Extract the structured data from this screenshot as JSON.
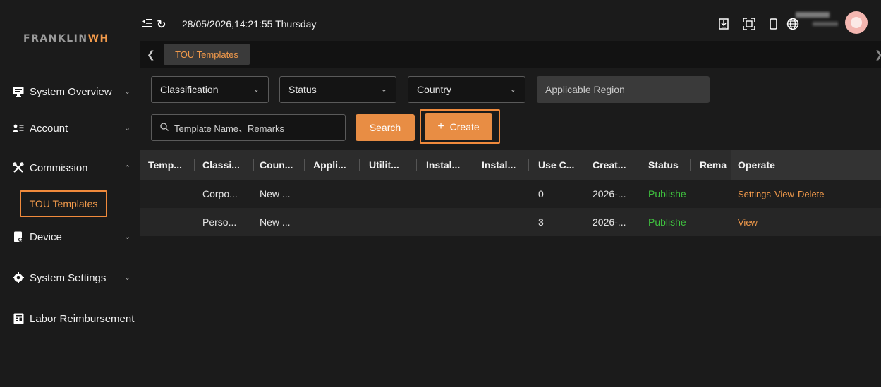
{
  "brand": {
    "logo_main": "FRANKLIN",
    "logo_accent": "WH"
  },
  "header": {
    "datetime": "28/05/2026,14:21:55 Thursday",
    "user_name": "",
    "user_role": ""
  },
  "sidebar": {
    "items": [
      {
        "label": "System Overview",
        "icon": "monitor-icon"
      },
      {
        "label": "Account",
        "icon": "account-icon"
      },
      {
        "label": "Commission",
        "icon": "tools-icon"
      },
      {
        "label": "Device",
        "icon": "device-icon"
      },
      {
        "label": "System Settings",
        "icon": "gear-icon"
      },
      {
        "label": "Labor Reimbursement",
        "icon": "receipt-icon"
      }
    ],
    "sub_item": {
      "label": "TOU Templates"
    }
  },
  "tabs": [
    {
      "label": "TOU Templates"
    }
  ],
  "filters": {
    "classification": "Classification",
    "status": "Status",
    "country": "Country",
    "applicable_region": "Applicable Region",
    "search_placeholder": "Template Name、Remarks",
    "search_label": "Search",
    "create_label": "Create"
  },
  "table": {
    "headers": [
      "Temp...",
      "Classi...",
      "Coun...",
      "Appli...",
      "Utilit...",
      "Instal...",
      "Instal...",
      "Use C...",
      "Creat...",
      "Status",
      "Rema",
      "Operate"
    ],
    "rows": [
      {
        "template": "",
        "classification": "Corpo...",
        "country": "New ...",
        "applicable": "",
        "utility": "",
        "install1": "",
        "install2": "",
        "use_count": "0",
        "created": "2026-...",
        "status": "Publishe",
        "remarks": "",
        "ops": [
          "Settings",
          "View",
          "Delete"
        ]
      },
      {
        "template": "",
        "classification": "Perso...",
        "country": "New ...",
        "applicable": "",
        "utility": "",
        "install1": "",
        "install2": "",
        "use_count": "3",
        "created": "2026-...",
        "status": "Publishe",
        "remarks": "",
        "ops": [
          "View"
        ]
      }
    ]
  },
  "colors": {
    "accent": "#e88d44",
    "published": "#3fc23f",
    "highlight": "#f08a3c"
  }
}
